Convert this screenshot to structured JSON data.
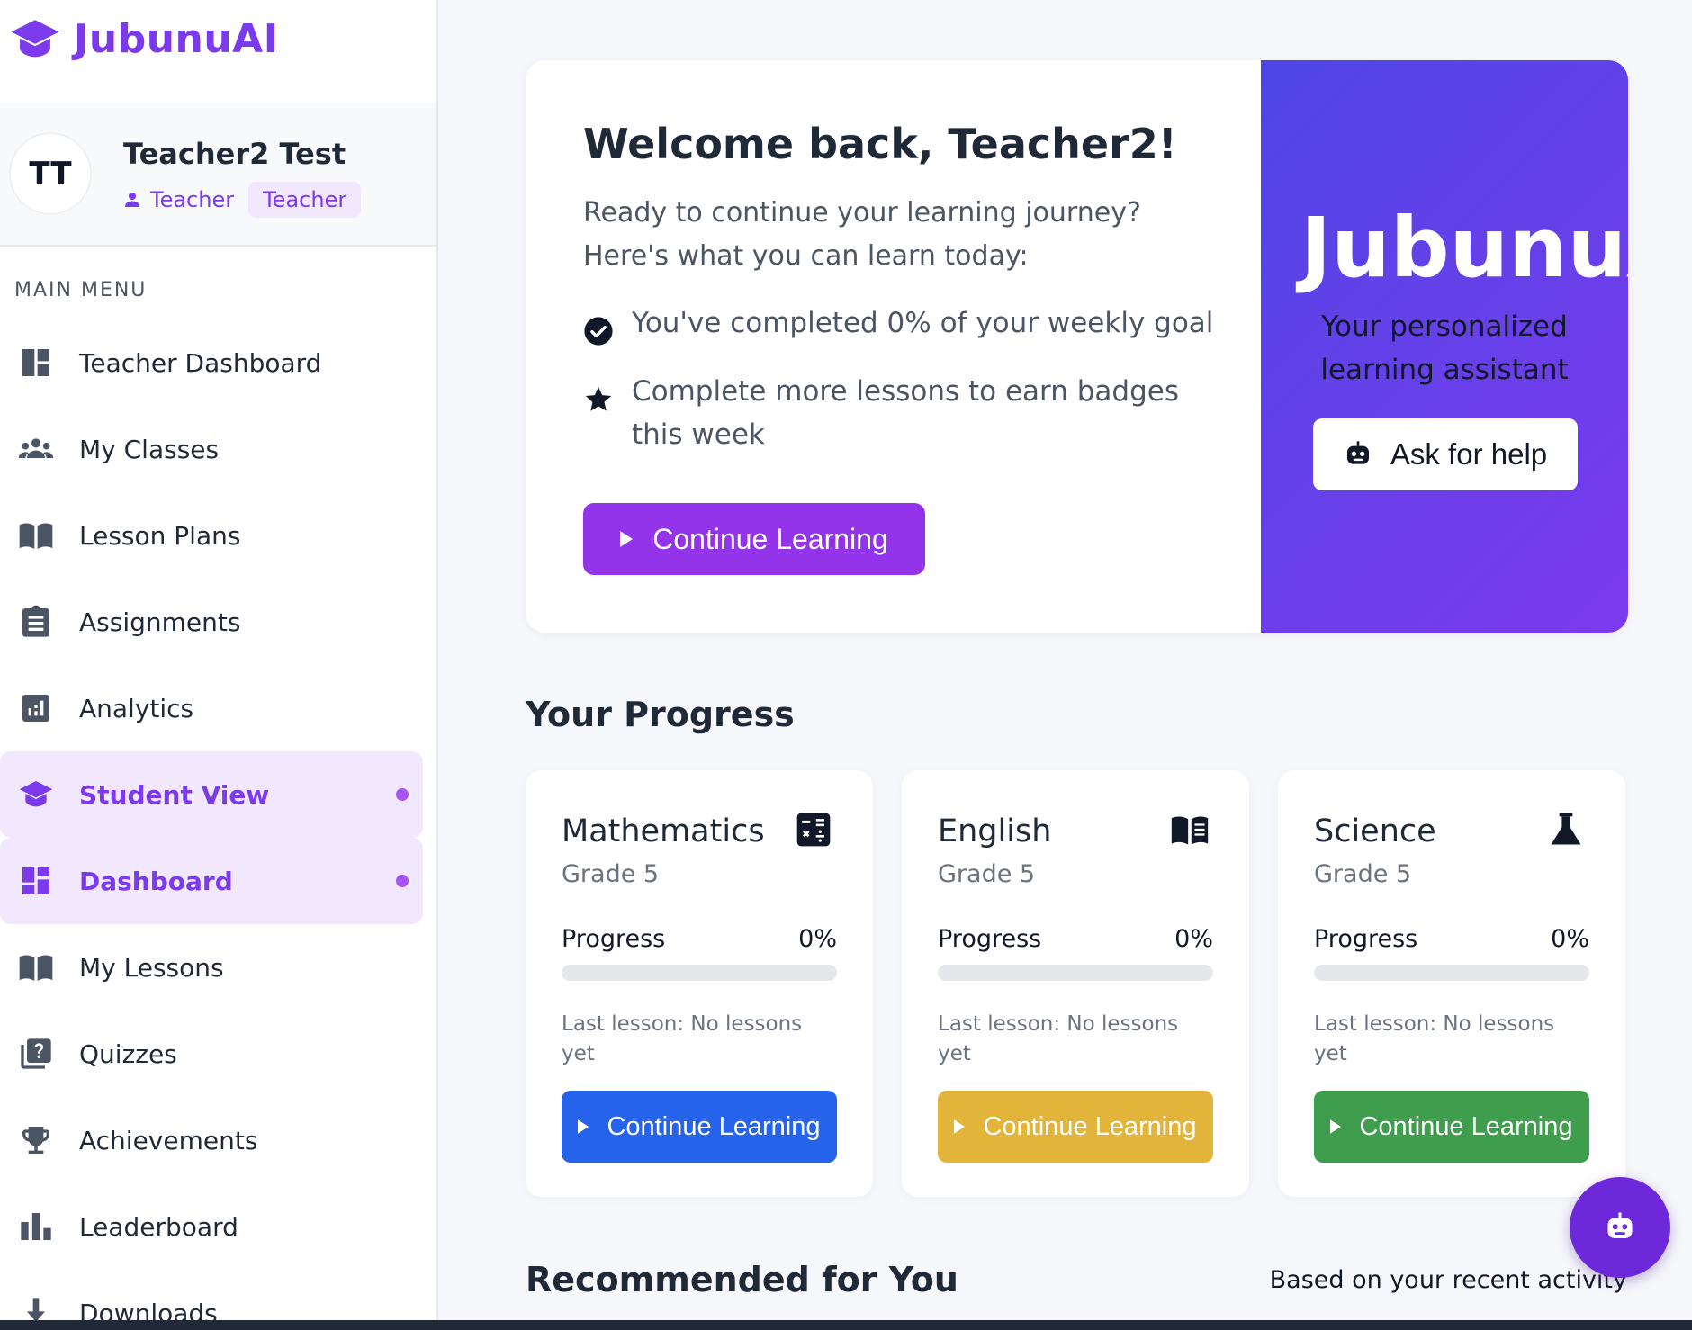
{
  "brand": {
    "name": "JubunuAI",
    "color": "#7c3aed"
  },
  "profile": {
    "initials": "TT",
    "name": "Teacher2 Test",
    "role": "Teacher",
    "badge": "Teacher"
  },
  "sidebar": {
    "menu_header": "MAIN MENU",
    "items": [
      {
        "label": "Teacher Dashboard",
        "icon": "dashboard-icon",
        "active": false
      },
      {
        "label": "My Classes",
        "icon": "group-icon",
        "active": false
      },
      {
        "label": "Lesson Plans",
        "icon": "book-open-icon",
        "active": false
      },
      {
        "label": "Assignments",
        "icon": "clipboard-icon",
        "active": false
      },
      {
        "label": "Analytics",
        "icon": "analytics-icon",
        "active": false
      },
      {
        "label": "Student View",
        "icon": "graduation-cap-icon",
        "active": true
      },
      {
        "label": "Dashboard",
        "icon": "dashboard-grid-icon",
        "active": true
      },
      {
        "label": "My Lessons",
        "icon": "book-open-icon",
        "active": false
      },
      {
        "label": "Quizzes",
        "icon": "quiz-icon",
        "active": false
      },
      {
        "label": "Achievements",
        "icon": "trophy-icon",
        "active": false
      },
      {
        "label": "Leaderboard",
        "icon": "leaderboard-icon",
        "active": false
      },
      {
        "label": "Downloads",
        "icon": "download-icon",
        "active": false
      }
    ]
  },
  "hero": {
    "title": "Welcome back, Teacher2!",
    "subtitle": "Ready to continue your learning journey? Here's what you can learn today:",
    "goals": [
      {
        "icon": "check-circle-icon",
        "text": "You've completed 0% of your weekly goal"
      },
      {
        "icon": "star-icon",
        "text": "Complete more lessons to earn badges this week"
      }
    ],
    "cta_label": "Continue Learning",
    "side_brand": "JubunuAI",
    "side_tagline": "Your personalized learning assistant",
    "help_label": "Ask for help",
    "accent": "#9333ea",
    "gradient_start": "#4f46e5",
    "gradient_end": "#7c3aed"
  },
  "progress_section": {
    "title": "Your Progress",
    "courses": [
      {
        "name": "Mathematics",
        "grade": "Grade 5",
        "progress_label": "Progress",
        "progress_value": "0%",
        "progress": 0,
        "last_lesson": "Last lesson: No lessons yet",
        "button_label": "Continue Learning",
        "button_color": "#2563eb",
        "icon": "calculator-icon"
      },
      {
        "name": "English",
        "grade": "Grade 5",
        "progress_label": "Progress",
        "progress_value": "0%",
        "progress": 0,
        "last_lesson": "Last lesson: No lessons yet",
        "button_label": "Continue Learning",
        "button_color": "#e3b43a",
        "icon": "book-icon"
      },
      {
        "name": "Science",
        "grade": "Grade 5",
        "progress_label": "Progress",
        "progress_value": "0%",
        "progress": 0,
        "last_lesson": "Last lesson: No lessons yet",
        "button_label": "Continue Learning",
        "button_color": "#3f9e4d",
        "icon": "flask-icon"
      }
    ]
  },
  "recommended": {
    "title": "Recommended for You",
    "note": "Based on your recent activity"
  },
  "fab": {
    "icon": "robot-icon",
    "color": "#6d28d9"
  }
}
